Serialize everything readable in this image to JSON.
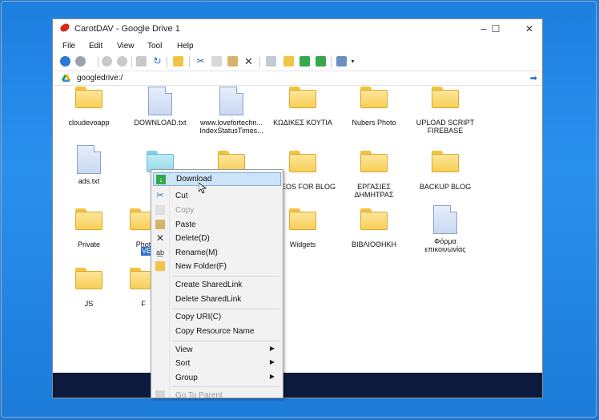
{
  "window": {
    "title": "CarotDAV - Google Drive 1"
  },
  "controls": {
    "minimize": "–",
    "maximize": "☐",
    "close": "✕"
  },
  "menu": [
    "File",
    "Edit",
    "View",
    "Tool",
    "Help"
  ],
  "address": {
    "path": "googledrive:/"
  },
  "files": [
    {
      "label": "cloudevoapp",
      "type": "folder"
    },
    {
      "label": "DOWNLOAD.txt",
      "type": "doc"
    },
    {
      "label": "www.lovefortechn...\nIndexStatusTimes...",
      "type": "doc"
    },
    {
      "label": "ΚΩΔΙΚΕΣ ΚΟΥΤΙΑ",
      "type": "folder"
    },
    {
      "label": "Nubers Photo",
      "type": "folder"
    },
    {
      "label": "UPLOAD SCRIPT\nFIREBASE",
      "type": "folder"
    },
    {
      "label": "ads.txt",
      "type": "doc"
    },
    {
      "label": "VE",
      "type": "folder"
    },
    {
      "label": "",
      "type": "folder"
    },
    {
      "label": "EOS FOR BLOG",
      "type": "folder"
    },
    {
      "label": "ΕΡΓΑΣΙΕΣ\nΔΗΜΗΤΡΑΣ",
      "type": "folder"
    },
    {
      "label": "BACKUP BLOG",
      "type": "folder"
    },
    {
      "label": "Private",
      "type": "folder"
    },
    {
      "label": "Phot",
      "type": "folder"
    },
    {
      "label": "Widgets",
      "type": "folder"
    },
    {
      "label": "ΒΙΒΛΙΟΘΗΚΗ",
      "type": "folder"
    },
    {
      "label": "Φόρμα\nεπικοινωνίας",
      "type": "doc"
    },
    {
      "label": "JS",
      "type": "folder"
    },
    {
      "label": "F",
      "type": "folder"
    }
  ],
  "context_menu": {
    "download": "Download",
    "cut": "Cut",
    "copy": "Copy",
    "paste": "Paste",
    "delete": "Delete(D)",
    "rename": "Rename(M)",
    "new_folder": "New Folder(F)",
    "create_shared_link": "Create SharedLink",
    "delete_shared_link": "Delete SharedLink",
    "copy_uri": "Copy URI(C)",
    "copy_resource_name": "Copy Resource Name",
    "view": "View",
    "sort": "Sort",
    "group": "Group",
    "go_to_parent": "Go To Parent"
  }
}
